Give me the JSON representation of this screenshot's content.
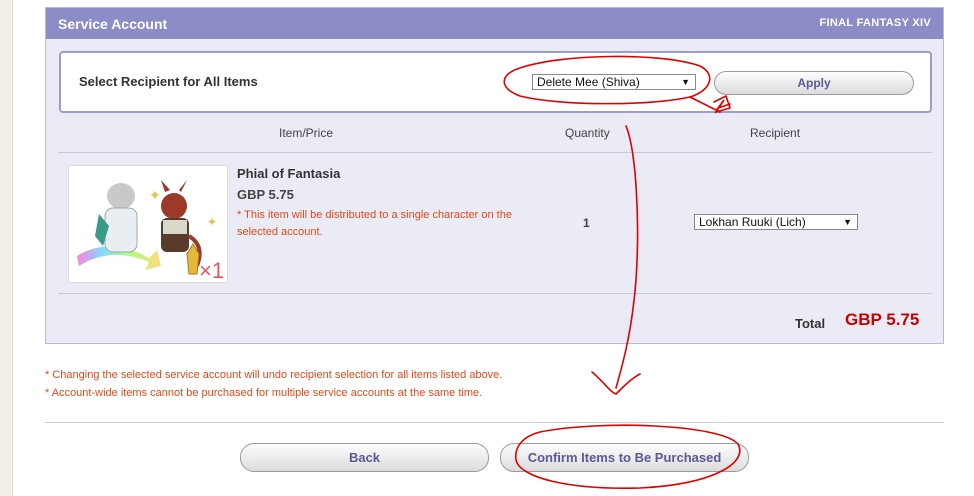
{
  "header": {
    "title": "Service Account",
    "game": "FINAL FANTASY XIV"
  },
  "recipient_all": {
    "label": "Select Recipient for All Items",
    "selected": "Delete Mee (Shiva)",
    "apply_label": "Apply"
  },
  "table": {
    "columns": [
      "Item/Price",
      "Quantity",
      "Recipient"
    ],
    "rows": [
      {
        "name": "Phial of Fantasia",
        "price": "GBP 5.75",
        "note": "* This item will be distributed to a single character on the selected account.",
        "quantity": "1",
        "recipient": "Lokhan Ruuki (Lich)",
        "image_badge": "×1"
      }
    ]
  },
  "total": {
    "label": "Total",
    "value": "GBP 5.75"
  },
  "notes": [
    "* Changing the selected service account will undo recipient selection for all items listed above.",
    "* Account-wide items cannot be purchased for multiple service accounts at the same time."
  ],
  "buttons": {
    "back": "Back",
    "confirm": "Confirm Items to Be Purchased"
  },
  "icons": {
    "dropdown": "dropdown-arrow-icon"
  },
  "colors": {
    "header_bg": "#8c8cc6",
    "panel_bg": "#ebebf5",
    "note_text": "#e04a1a",
    "total_value": "#cc0000",
    "annotation": "#e00000"
  }
}
